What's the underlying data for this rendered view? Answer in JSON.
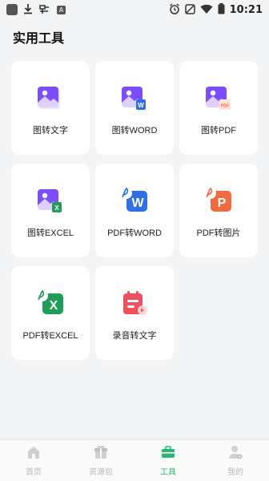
{
  "status_bar": {
    "time": "10:21",
    "left_icons": [
      "app-square-icon",
      "download-icon",
      "nfc-icon",
      "a-box-icon"
    ],
    "right_icons": [
      "alarm-icon",
      "silent-icon",
      "wifi-icon",
      "battery-icon"
    ],
    "a_box_text": "A"
  },
  "page": {
    "title": "实用工具"
  },
  "tools": [
    {
      "label": "图转文字",
      "icon": "image-to-text-icon",
      "badge": ""
    },
    {
      "label": "图转WORD",
      "icon": "image-to-word-icon",
      "badge": "W"
    },
    {
      "label": "图转PDF",
      "icon": "image-to-pdf-icon",
      "badge": "PDF"
    },
    {
      "label": "图转EXCEL",
      "icon": "image-to-excel-icon",
      "badge": "X"
    },
    {
      "label": "PDF转WORD",
      "icon": "pdf-to-word-icon",
      "badge": "W"
    },
    {
      "label": "PDF转图片",
      "icon": "pdf-to-image-icon",
      "badge": "P"
    },
    {
      "label": "PDF转EXCEL",
      "icon": "pdf-to-excel-icon",
      "badge": "X"
    },
    {
      "label": "录音转文字",
      "icon": "audio-to-text-icon",
      "badge": ""
    }
  ],
  "bottom_nav": [
    {
      "label": "首页",
      "icon": "home-icon",
      "active": false
    },
    {
      "label": "资源包",
      "icon": "gift-icon",
      "active": false
    },
    {
      "label": "工具",
      "icon": "toolbox-icon",
      "active": true
    },
    {
      "label": "我的",
      "icon": "profile-icon",
      "active": false
    }
  ],
  "colors": {
    "active_green": "#2bb673",
    "inactive_gray": "#c9c9c9",
    "purple": "#7c4dff",
    "word_blue": "#2f6fe4",
    "pdf_orange": "#f06b3f",
    "excel_green": "#1e9e5a",
    "audio_red": "#f0505d"
  }
}
